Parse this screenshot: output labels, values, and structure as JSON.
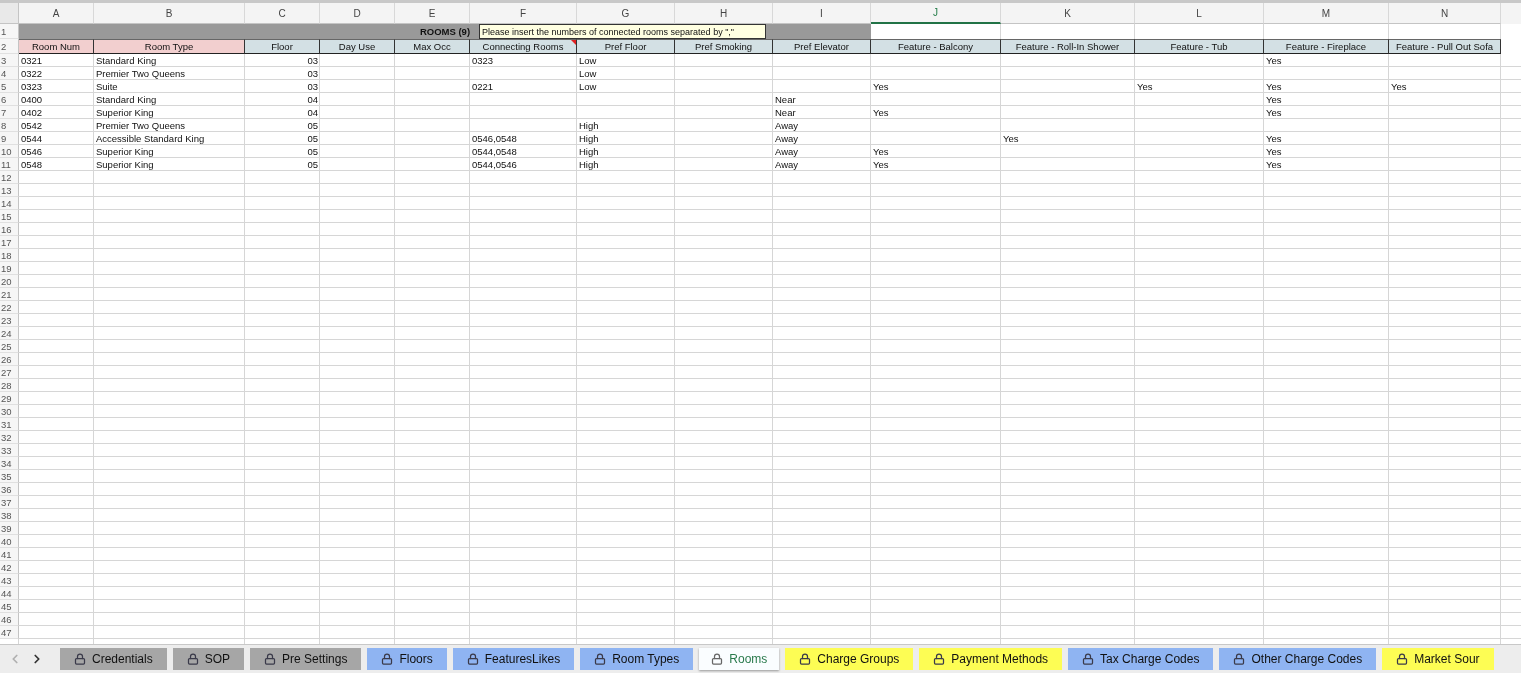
{
  "columns": [
    {
      "letter": "A",
      "selected": false
    },
    {
      "letter": "B",
      "selected": false
    },
    {
      "letter": "C",
      "selected": false
    },
    {
      "letter": "D",
      "selected": false
    },
    {
      "letter": "E",
      "selected": false
    },
    {
      "letter": "F",
      "selected": false
    },
    {
      "letter": "G",
      "selected": false
    },
    {
      "letter": "H",
      "selected": false
    },
    {
      "letter": "I",
      "selected": false
    },
    {
      "letter": "J",
      "selected": true
    },
    {
      "letter": "K",
      "selected": false
    },
    {
      "letter": "L",
      "selected": false
    },
    {
      "letter": "M",
      "selected": false
    },
    {
      "letter": "N",
      "selected": false
    }
  ],
  "title_row": {
    "number": "1",
    "title": "ROOMS (9)"
  },
  "comment": {
    "text": "Please insert the numbers of connected rooms separated by \",\""
  },
  "header_row": {
    "number": "2",
    "cells": [
      {
        "label": "Room Num",
        "color": "#f2cfcf"
      },
      {
        "label": "Room Type",
        "color": "#f2cfcf"
      },
      {
        "label": "Floor",
        "color": "#d3e0e4"
      },
      {
        "label": "Day Use",
        "color": "#d3e0e4"
      },
      {
        "label": "Max Occ",
        "color": "#d3e0e4"
      },
      {
        "label": "Connecting Rooms",
        "color": "#d3e0e4",
        "has_comment": true
      },
      {
        "label": "Pref Floor",
        "color": "#d3e0e4"
      },
      {
        "label": "Pref Smoking",
        "color": "#d3e0e4"
      },
      {
        "label": "Pref Elevator",
        "color": "#d3e0e4"
      },
      {
        "label": "Feature - Balcony",
        "color": "#d3e0e4"
      },
      {
        "label": "Feature - Roll-In Shower",
        "color": "#d3e0e4"
      },
      {
        "label": "Feature - Tub",
        "color": "#d3e0e4"
      },
      {
        "label": "Feature - Fireplace",
        "color": "#d3e0e4"
      },
      {
        "label": "Feature - Pull Out Sofa",
        "color": "#d3e0e4"
      }
    ]
  },
  "rows": [
    {
      "number": "3",
      "cells": {
        "A": "0321",
        "B": "Standard King",
        "C": "03",
        "F": "0323",
        "G": "Low",
        "M": "Yes"
      }
    },
    {
      "number": "4",
      "cells": {
        "A": "0322",
        "B": "Premier Two Queens",
        "C": "03",
        "G": "Low"
      }
    },
    {
      "number": "5",
      "cells": {
        "A": "0323",
        "B": "Suite",
        "C": "03",
        "F": "0221",
        "G": "Low",
        "J": "Yes",
        "L": "Yes",
        "M": "Yes",
        "N": "Yes"
      }
    },
    {
      "number": "6",
      "cells": {
        "A": "0400",
        "B": "Standard King",
        "C": "04",
        "I": "Near",
        "M": "Yes"
      }
    },
    {
      "number": "7",
      "cells": {
        "A": "0402",
        "B": "Superior King",
        "C": "04",
        "I": "Near",
        "J": "Yes",
        "M": "Yes"
      }
    },
    {
      "number": "8",
      "cells": {
        "A": "0542",
        "B": "Premier Two Queens",
        "C": "05",
        "G": "High",
        "I": "Away"
      }
    },
    {
      "number": "9",
      "cells": {
        "A": "0544",
        "B": "Accessible Standard King",
        "C": "05",
        "F": "0546,0548",
        "G": "High",
        "I": "Away",
        "K": "Yes",
        "M": "Yes"
      }
    },
    {
      "number": "10",
      "cells": {
        "A": "0546",
        "B": "Superior King",
        "C": "05",
        "F": "0544,0548",
        "G": "High",
        "I": "Away",
        "J": "Yes",
        "M": "Yes"
      }
    },
    {
      "number": "11",
      "cells": {
        "A": "0548",
        "B": "Superior King",
        "C": "05",
        "F": "0544,0546",
        "G": "High",
        "I": "Away",
        "J": "Yes",
        "M": "Yes"
      }
    }
  ],
  "empty_row_numbers": [
    "12",
    "13",
    "14",
    "15",
    "16",
    "17",
    "18",
    "19",
    "20",
    "21",
    "22",
    "23",
    "24",
    "25",
    "26",
    "27",
    "28",
    "29",
    "30",
    "31",
    "32",
    "33",
    "34",
    "35",
    "36",
    "37",
    "38",
    "39",
    "40",
    "41",
    "42",
    "43",
    "44",
    "45",
    "46",
    "47"
  ],
  "tabs": [
    {
      "label": "Credentials",
      "color": "#a6a6a6",
      "selected": false
    },
    {
      "label": "SOP",
      "color": "#a6a6a6",
      "selected": false
    },
    {
      "label": "Pre Settings",
      "color": "#a6a6a6",
      "selected": false
    },
    {
      "label": "Floors",
      "color": "#8fb4f2",
      "selected": false
    },
    {
      "label": "FeaturesLikes",
      "color": "#8fb4f2",
      "selected": false
    },
    {
      "label": "Room Types",
      "color": "#8fb4f2",
      "selected": false
    },
    {
      "label": "Rooms",
      "selected": true
    },
    {
      "label": "Charge Groups",
      "color": "#fdfd54",
      "selected": false
    },
    {
      "label": "Payment Methods",
      "color": "#fdfd54",
      "selected": false
    },
    {
      "label": "Tax Charge Codes",
      "color": "#8fb4f2",
      "selected": false
    },
    {
      "label": "Other Charge Codes",
      "color": "#8fb4f2",
      "selected": false
    },
    {
      "label": "Market Sour",
      "color": "#fdfd54",
      "selected": false
    }
  ]
}
